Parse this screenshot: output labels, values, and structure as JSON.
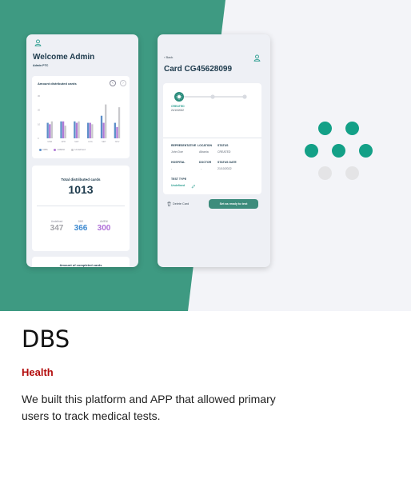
{
  "colors": {
    "green": "#3e9a82",
    "teal_dot": "#13a087",
    "grey_dot": "#e4e4e6",
    "blue_bar": "#5d8fc9",
    "purple_bar": "#b07ad6",
    "grey_bar": "#c9c9cc",
    "accent_red": "#b30d0d"
  },
  "dashboard": {
    "title": "Welcome Admin",
    "subtitle": "Admin PTC",
    "chart_card": {
      "title": "Amount distributed cards",
      "prev_icon": "chevron-left-icon",
      "next_icon": "chevron-right-icon"
    },
    "total_card": {
      "label": "Total distributed cards",
      "value": "1013",
      "stats": [
        {
          "label": "Undefined",
          "value": "347",
          "color": "#a3a3a8"
        },
        {
          "label": "DBS",
          "value": "366",
          "color": "#3e8ad0"
        },
        {
          "label": "AMENI",
          "value": "300",
          "color": "#b06fd8"
        }
      ]
    },
    "completed_card": {
      "title": "Amount of completed cards"
    }
  },
  "chart_data": {
    "type": "bar",
    "title": "Amount distributed cards",
    "categories": [
      "MAR",
      "APR",
      "MAY",
      "AUG",
      "SEP",
      "NOV"
    ],
    "series": [
      {
        "name": "DBS",
        "color": "#5d8fc9",
        "values": [
          11,
          12,
          12,
          11,
          16,
          11
        ]
      },
      {
        "name": "AMENI",
        "color": "#b07ad6",
        "values": [
          10,
          12,
          11,
          11,
          11,
          8
        ]
      },
      {
        "name": "Undefined",
        "color": "#c9c9cc",
        "values": [
          12,
          9,
          12,
          10,
          24,
          22
        ]
      }
    ],
    "yticks": [
      "30",
      "20",
      "10",
      "0"
    ],
    "ylim": [
      0,
      30
    ],
    "grid": false,
    "legend_position": "bottom-left"
  },
  "card_detail": {
    "back_label": "Back",
    "title": "Card CG45628099",
    "status_step": {
      "label": "CREATED",
      "date": "21/10/2022",
      "icon": "virus-icon"
    },
    "columns_row1": {
      "headers": [
        "REPRESENTATIVE",
        "LOCATION",
        "STATUS"
      ],
      "values": [
        "John Doe",
        "Albania",
        "CREATED"
      ]
    },
    "columns_row2": {
      "headers": [
        "HOSPITAL",
        "DOCTOR",
        "STATUS DATE"
      ],
      "values": [
        "-",
        "-",
        "21/10/2022"
      ]
    },
    "test_type": {
      "header": "TEST TYPE",
      "value": "Undefined",
      "edit_icon": "pencil-icon"
    },
    "delete_label": "Delete Card",
    "delete_icon": "trash-icon",
    "ready_label": "Set as ready to test"
  },
  "project": {
    "name": "DBS",
    "category": "Health",
    "description": "We built this platform and APP that allowed primary users to track medical tests."
  }
}
